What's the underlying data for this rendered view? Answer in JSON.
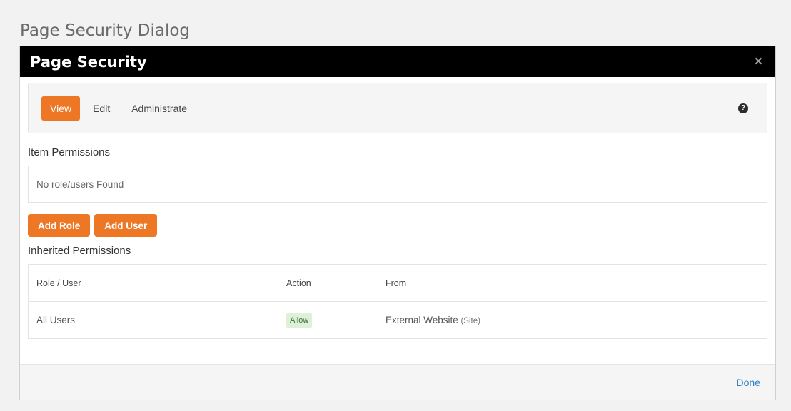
{
  "caption": "Page Security Dialog",
  "modal": {
    "title": "Page Security",
    "close_glyph": "×"
  },
  "tabs": [
    {
      "label": "View",
      "active": true
    },
    {
      "label": "Edit",
      "active": false
    },
    {
      "label": "Administrate",
      "active": false
    }
  ],
  "help_icon": {
    "name": "question-circle-icon",
    "glyph": "?"
  },
  "item_permissions": {
    "title": "Item Permissions",
    "empty_text": "No role/users Found"
  },
  "buttons": {
    "add_role": "Add Role",
    "add_user": "Add User"
  },
  "inherited_permissions": {
    "title": "Inherited Permissions",
    "columns": [
      "Role / User",
      "Action",
      "From"
    ],
    "rows": [
      {
        "role": "All Users",
        "action": "Allow",
        "from": "External Website",
        "from_type": "(Site)"
      }
    ]
  },
  "footer": {
    "done_label": "Done"
  },
  "colors": {
    "accent": "#ee7725",
    "header_bg": "#000000",
    "link": "#2b82c9",
    "allow_badge_bg": "#dff0d8",
    "allow_badge_text": "#3c763d"
  }
}
